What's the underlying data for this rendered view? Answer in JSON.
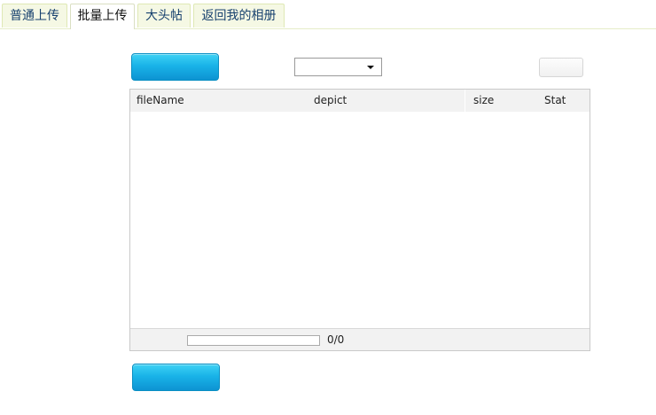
{
  "tabs": [
    {
      "label": "普通上传",
      "active": false
    },
    {
      "label": "批量上传",
      "active": true
    },
    {
      "label": "大头帖",
      "active": false
    },
    {
      "label": "返回我的相册",
      "active": false
    }
  ],
  "toolbar": {
    "select_value": ""
  },
  "file_list": {
    "columns": [
      "fileName",
      "depict",
      "size",
      "Stat"
    ],
    "rows": []
  },
  "footer": {
    "progress": 0,
    "count": "0/0"
  },
  "colors": {
    "accent": "#19b3e8",
    "tab_border": "#dfe8b5",
    "tab_text": "#16406e"
  }
}
